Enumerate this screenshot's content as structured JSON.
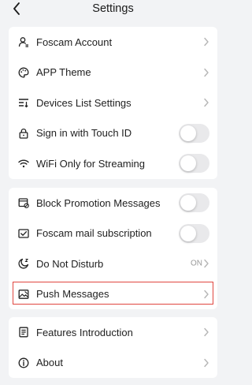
{
  "header": {
    "title": "Settings"
  },
  "groups": [
    {
      "items": [
        {
          "label": "Foscam Account",
          "icon": "user-icon",
          "control": "chevron"
        },
        {
          "label": "APP Theme",
          "icon": "palette-icon",
          "control": "chevron"
        },
        {
          "label": "Devices List Settings",
          "icon": "sort-list-icon",
          "control": "chevron"
        },
        {
          "label": "Sign in with Touch ID",
          "icon": "lock-icon",
          "control": "toggle",
          "on": false
        },
        {
          "label": "WiFi Only for Streaming",
          "icon": "wifi-icon",
          "control": "toggle",
          "on": false
        }
      ]
    },
    {
      "items": [
        {
          "label": "Block Promotion Messages",
          "icon": "block-message-icon",
          "control": "toggle",
          "on": false
        },
        {
          "label": "Foscam mail subscription",
          "icon": "mail-check-icon",
          "control": "toggle",
          "on": false
        },
        {
          "label": "Do Not Disturb",
          "icon": "moon-icon",
          "control": "value",
          "value": "ON"
        },
        {
          "label": "Push Messages",
          "icon": "image-message-icon",
          "control": "chevron",
          "highlighted": true
        }
      ]
    },
    {
      "items": [
        {
          "label": "Features Introduction",
          "icon": "document-icon",
          "control": "chevron"
        },
        {
          "label": "About",
          "icon": "info-icon",
          "control": "chevron"
        }
      ]
    }
  ],
  "colors": {
    "background": "#f2f3f5",
    "toggle_off": "#e9e9eb",
    "highlight": "#e0463f"
  }
}
